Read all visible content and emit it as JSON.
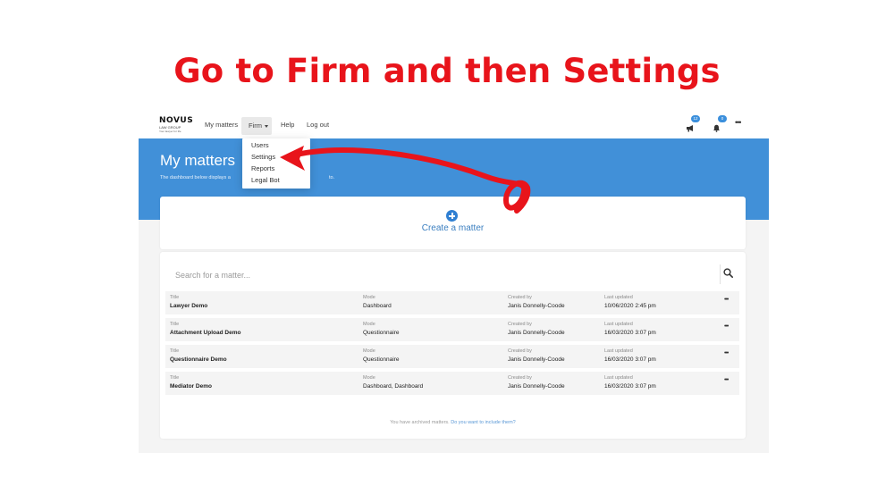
{
  "annotation": {
    "headline": "Go to Firm and then Settings",
    "color": "#e8141b"
  },
  "navbar": {
    "logo": {
      "main": "NOVUS",
      "sub": "LAW GROUP",
      "tag": "Your lawyer for life"
    },
    "items": [
      {
        "label": "My matters"
      },
      {
        "label": "Firm"
      },
      {
        "label": "Help"
      },
      {
        "label": "Log out"
      }
    ],
    "announcements_count": "12",
    "notifications_count": "0",
    "more_label": "•••"
  },
  "firm_menu": {
    "items": [
      "Users",
      "Settings",
      "Reports",
      "Legal Bot"
    ]
  },
  "hero": {
    "title": "My matters.",
    "subtitle_start": "The dashboard below displays a",
    "subtitle_end": "to.",
    "color": "#4190d8"
  },
  "create": {
    "label": "Create a matter"
  },
  "search": {
    "placeholder": "Search for a matter...",
    "value": ""
  },
  "columns": {
    "title": "Title",
    "mode": "Mode",
    "created_by": "Created by",
    "last_updated": "Last updated"
  },
  "matters": [
    {
      "title": "Lawyer Demo",
      "mode": "Dashboard",
      "created_by": "Janis Donnelly-Coode",
      "last_updated": "10/06/2020 2:45 pm"
    },
    {
      "title": "Attachment Upload Demo",
      "mode": "Questionnaire",
      "created_by": "Janis Donnelly-Coode",
      "last_updated": "16/03/2020 3:07 pm"
    },
    {
      "title": "Questionnaire Demo",
      "mode": "Questionnaire",
      "created_by": "Janis Donnelly-Coode",
      "last_updated": "16/03/2020 3:07 pm"
    },
    {
      "title": "Mediator Demo",
      "mode": "Dashboard, Dashboard",
      "created_by": "Janis Donnelly-Coode",
      "last_updated": "16/03/2020 3:07 pm"
    }
  ],
  "row_menu_label": "•••",
  "archived": {
    "text": "You have archived matters.",
    "link": "Do you want to include them?"
  }
}
